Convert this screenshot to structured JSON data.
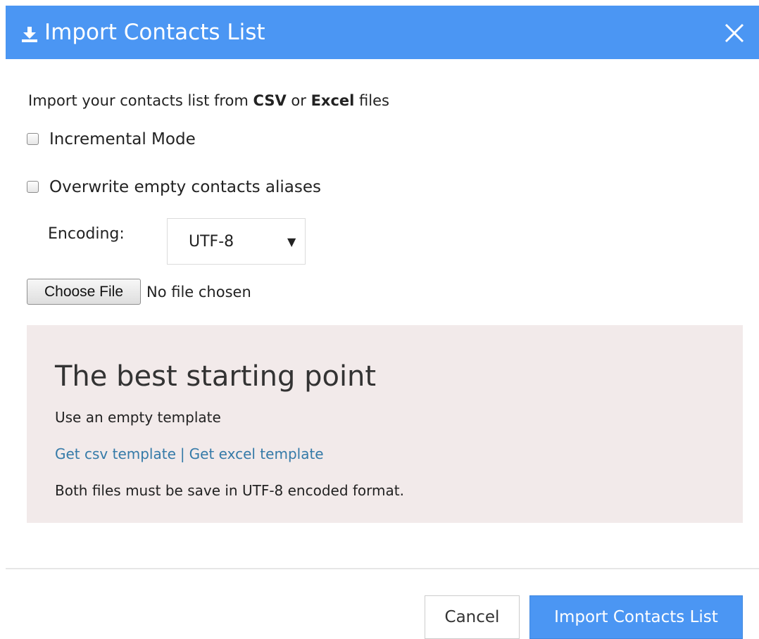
{
  "dialog": {
    "title": "Import Contacts List",
    "header_icon": "download-icon",
    "close_icon": "close-icon"
  },
  "intro": {
    "prefix": "Import your contacts list from ",
    "csv": "CSV",
    "middle": " or ",
    "excel": "Excel",
    "suffix": " files"
  },
  "options": {
    "incremental_mode": {
      "label": "Incremental Mode",
      "checked": false
    },
    "overwrite_aliases": {
      "label": "Overwrite empty contacts aliases",
      "checked": false
    }
  },
  "encoding": {
    "label": "Encoding:",
    "selected": "UTF-8",
    "arrow": "▼"
  },
  "file": {
    "button_label": "Choose File",
    "status": "No file chosen"
  },
  "info": {
    "title": "The best starting point",
    "subtitle": "Use an empty template",
    "csv_link": "Get csv template",
    "separator": "|",
    "excel_link": "Get excel template",
    "note": "Both files must be save in UTF-8 encoded format."
  },
  "footer": {
    "cancel_label": "Cancel",
    "import_label": "Import Contacts List"
  },
  "colors": {
    "header_bg": "#4b96f3",
    "info_bg": "#f2eaea",
    "link": "#357aa8"
  }
}
